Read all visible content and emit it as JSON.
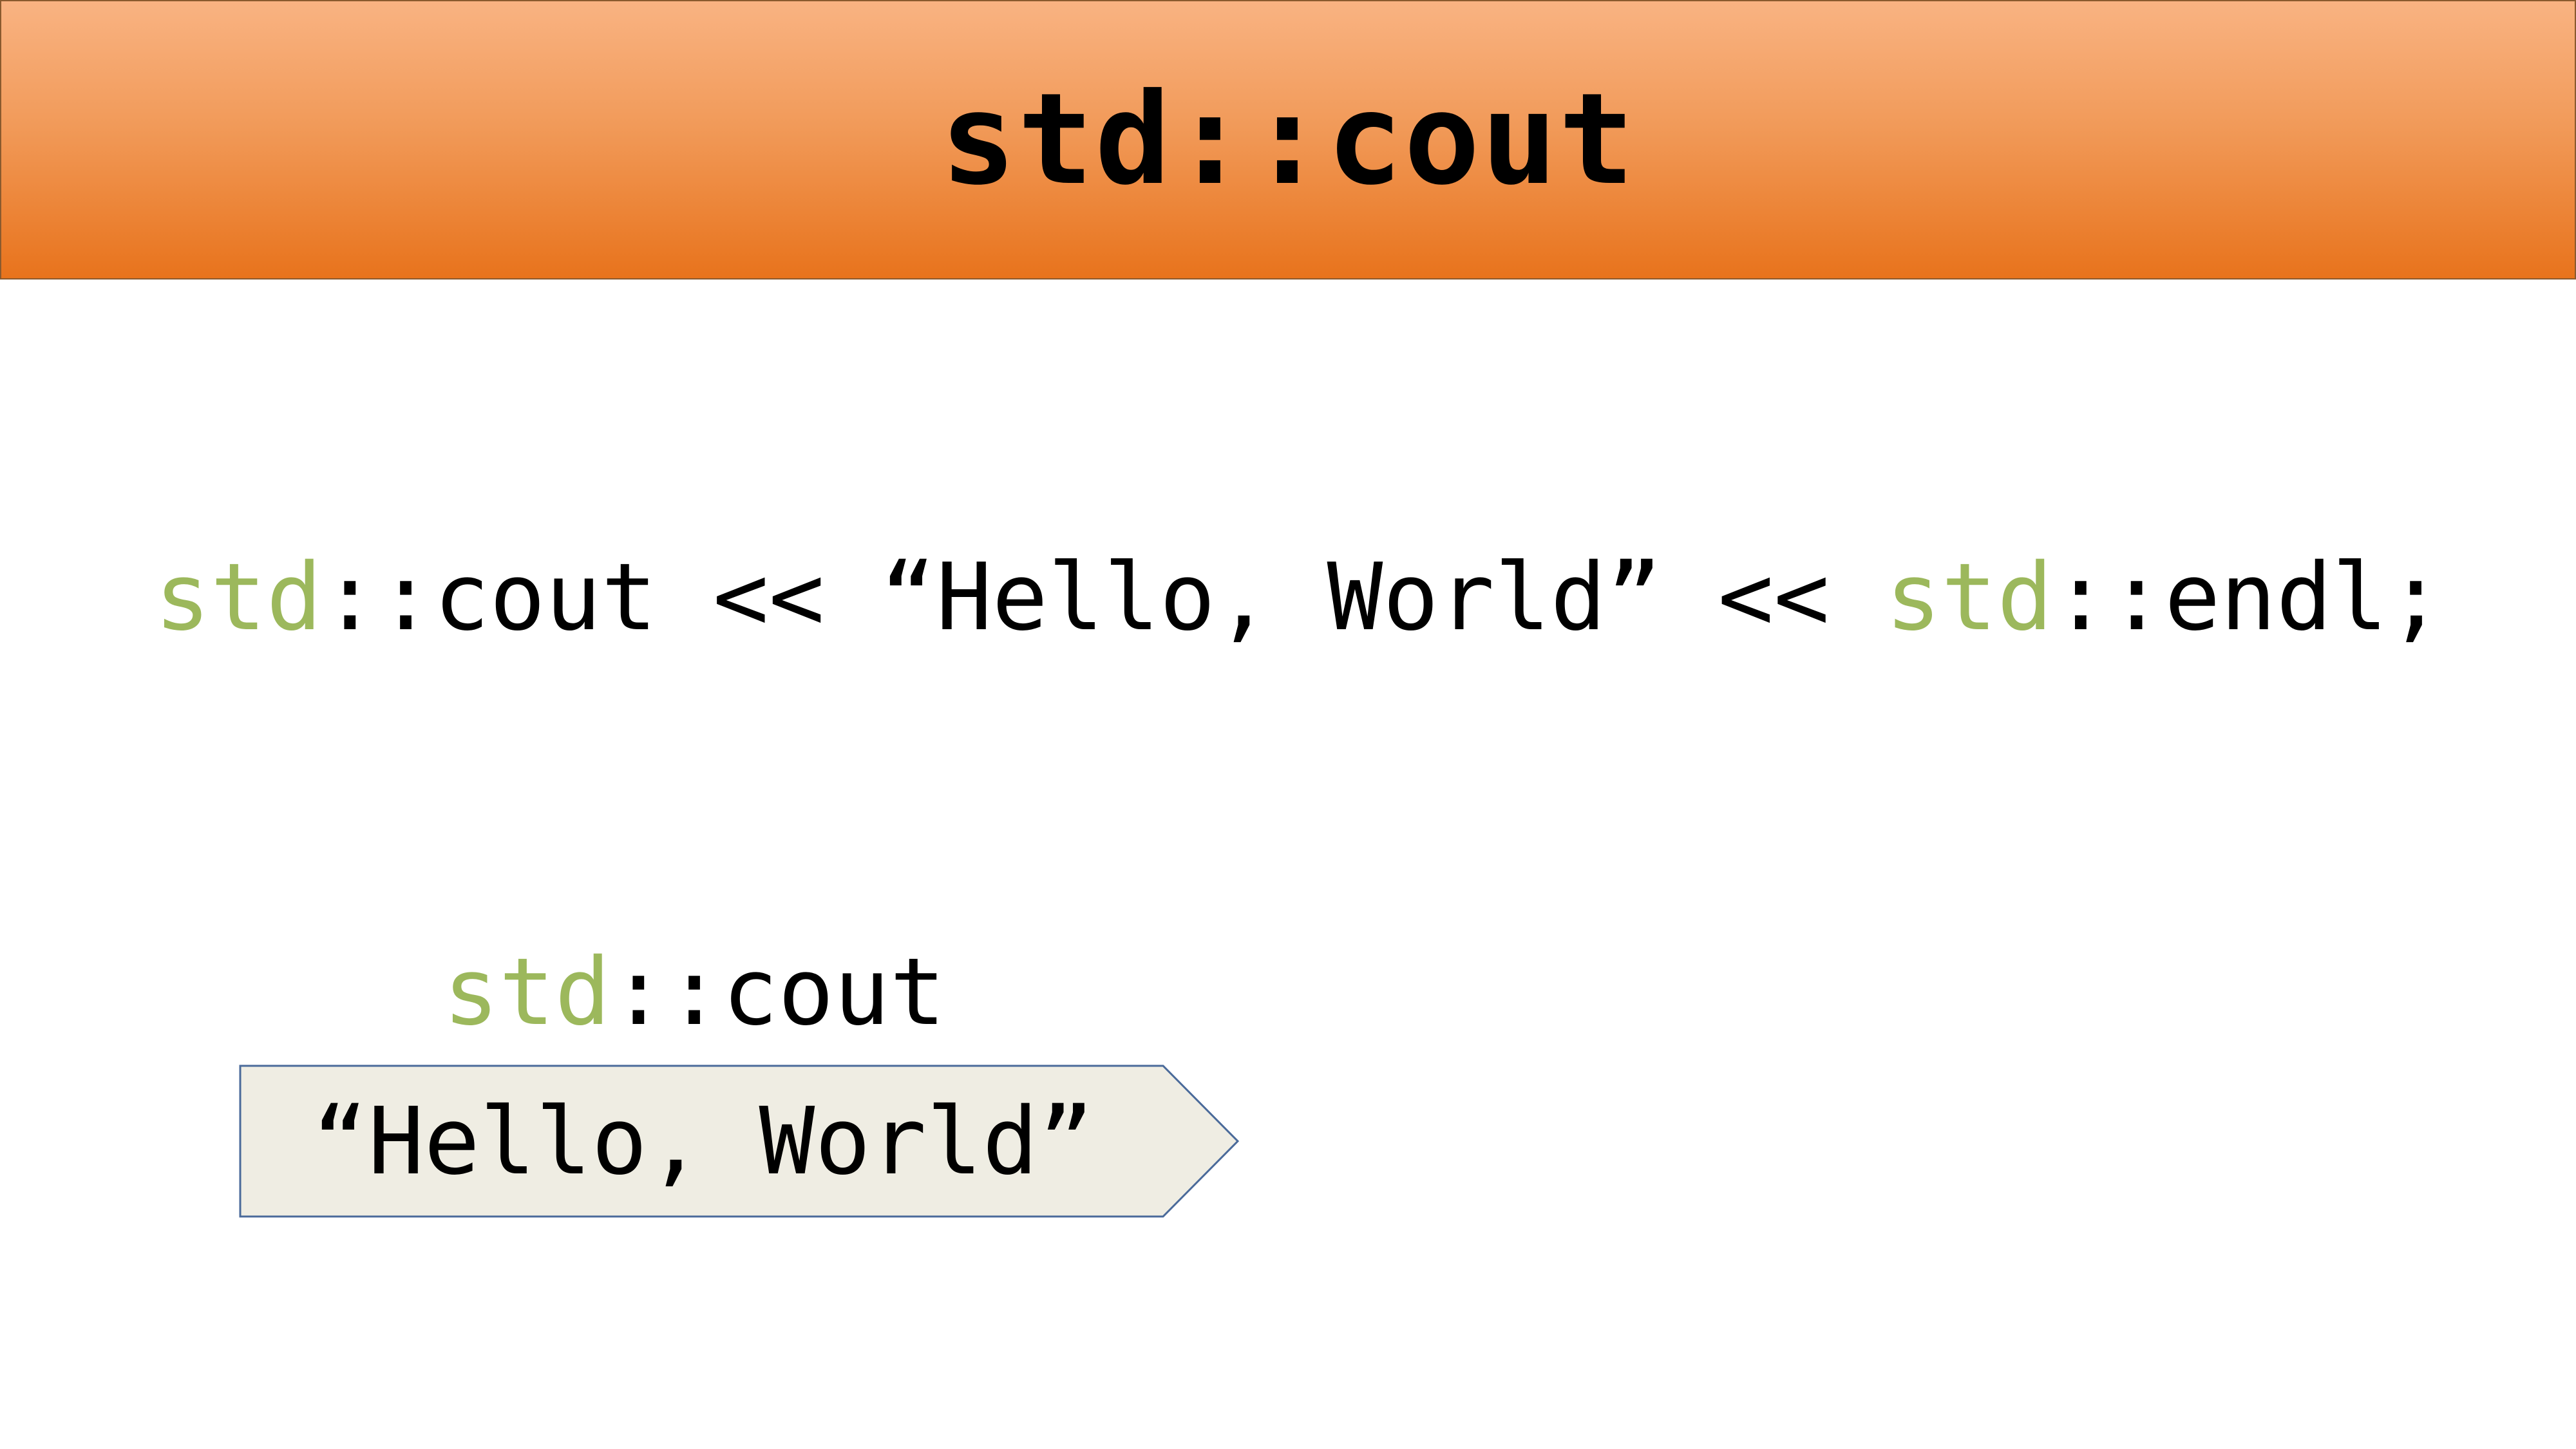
{
  "slide": {
    "title": "std::cout"
  },
  "code": {
    "ns1": "std",
    "part1": "::cout << “Hello, World” << ",
    "ns2": "std",
    "part2": "::endl;"
  },
  "diagram": {
    "stream_ns": "std",
    "stream_rest": "::cout",
    "arrow_text": "“Hello, World”"
  },
  "colors": {
    "header_top": "#f9b382",
    "header_bottom": "#e8731c",
    "namespace_green": "#9cb85c",
    "arrow_fill": "#efede3",
    "arrow_border": "#4a6a9a"
  }
}
